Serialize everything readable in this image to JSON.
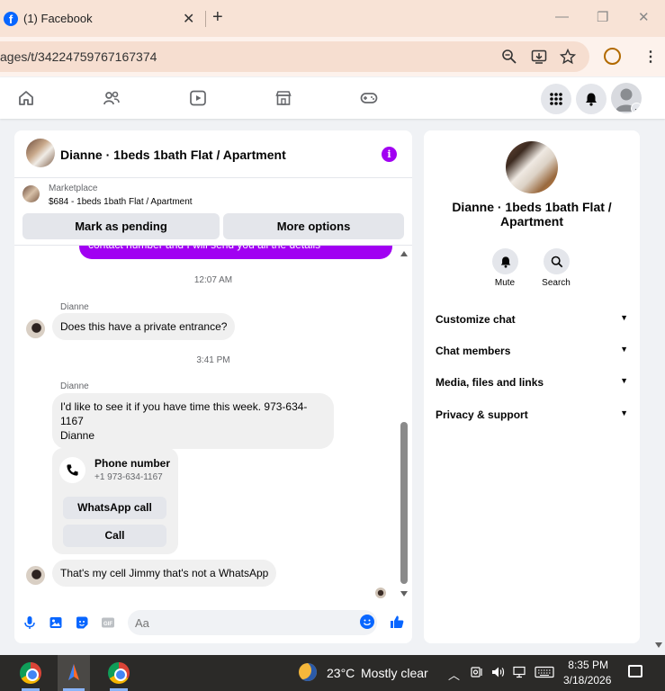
{
  "browser": {
    "tab_title": "(1) Facebook",
    "url": "ages/t/34224759767167374"
  },
  "fb_nav": {
    "icons": [
      "home-icon",
      "friends-icon",
      "video-icon",
      "marketplace-icon",
      "gaming-icon"
    ],
    "right_icons": [
      "menu-grid-icon",
      "notifications-icon",
      "profile-avatar"
    ]
  },
  "chat": {
    "header_title": "Dianne · 1beds 1bath Flat / Apartment",
    "marketplace_label": "Marketplace",
    "marketplace_listing": "$684 - 1beds 1bath Flat / Apartment",
    "mark_pending": "Mark as pending",
    "more_options": "More options",
    "sent_partial": "contact number and I will send you all the details",
    "time1": "12:07 AM",
    "sender1": "Dianne",
    "msg1": "Does this have a private entrance?",
    "time2": "3:41 PM",
    "sender2": "Dianne",
    "msg2_line1": "I'd like to see it if you have time this week. 973-634-",
    "msg2_line2": "1167",
    "msg2_line3": "Dianne",
    "phone_title": "Phone number",
    "phone_num": "+1 973-634-1167",
    "whatsapp_btn": "WhatsApp call",
    "call_btn": "Call",
    "msg3": "That's my cell Jimmy that's not a WhatsApp",
    "composer_placeholder": "Aa"
  },
  "info_panel": {
    "title": "Dianne · 1beds 1bath Flat / Apartment",
    "mute": "Mute",
    "search": "Search",
    "sections": [
      "Customize chat",
      "Chat members",
      "Media, files and links",
      "Privacy & support"
    ]
  },
  "taskbar": {
    "temp": "23°C",
    "weather": "Mostly clear",
    "time": "8:35 PM",
    "date": "3/18/2026"
  },
  "colors": {
    "accent_purple": "#a100f2",
    "fb_blue": "#0866ff"
  }
}
